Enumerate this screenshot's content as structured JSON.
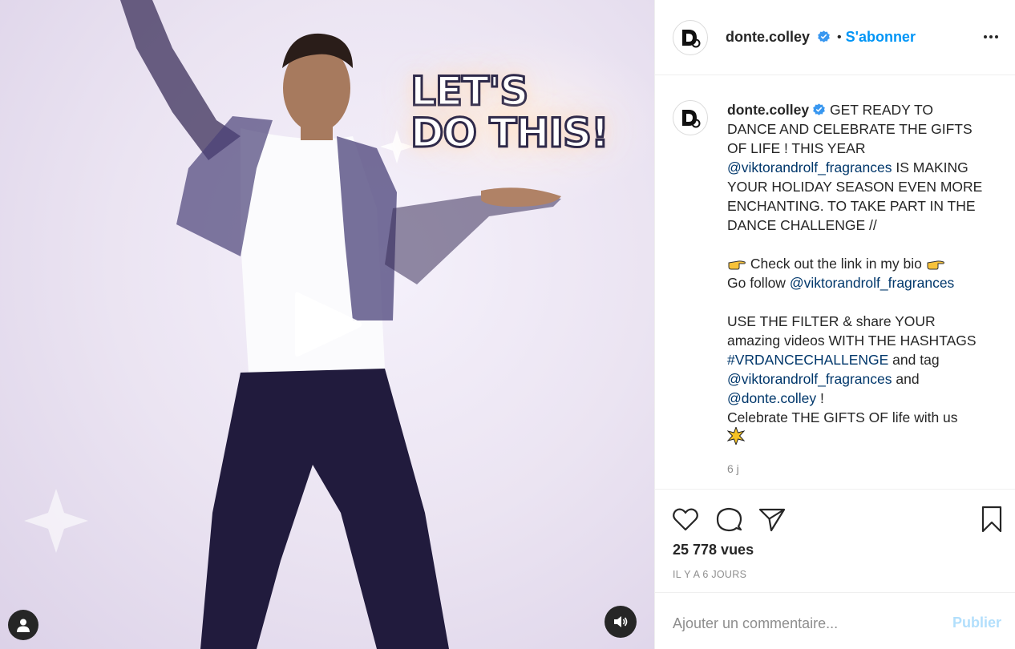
{
  "media": {
    "overlay_line1": "LET'S",
    "overlay_line2": "DO THIS!"
  },
  "header": {
    "username": "donte.colley",
    "separator": "•",
    "follow_label": "S'abonner",
    "more_icon": "more-horizontal-icon"
  },
  "caption": {
    "username": "donte.colley",
    "line1": "GET READY TO",
    "line2": "DANCE AND CELEBRATE THE GIFTS",
    "line3": "OF LIFE ! THIS YEAR",
    "mention1": "@viktorandrolf_fragrances",
    "line4_rest": " IS MAKING",
    "line5": "YOUR HOLIDAY SEASON EVEN MORE",
    "line6": "ENCHANTING. TO TAKE PART IN THE",
    "line7": "DANCE CHALLENGE //",
    "check_text": " Check out the link in my bio ",
    "go_follow": "Go follow ",
    "mention2": "@viktorandrolf_fragrances",
    "use_filter": "USE THE FILTER & share YOUR",
    "amazing": "amazing videos WITH THE HASHTAGS",
    "hashtag": "#VRDANCECHALLENGE",
    "and_tag": " and tag",
    "mention3": "@viktorandrolf_fragrances",
    "and": " and",
    "mention4": "@donte.colley",
    "exclaim": " !",
    "celebrate": "Celebrate THE GIFTS OF life with us",
    "time_ago": "6 j"
  },
  "actions": {
    "views": "25 778 vues",
    "posted": "IL Y A 6 JOURS"
  },
  "comment": {
    "placeholder": "Ajouter un commentaire...",
    "publish_label": "Publier"
  },
  "colors": {
    "link": "#0095f6",
    "mention": "#00376b",
    "verified": "#3897f0",
    "publish_disabled": "#b2dffc"
  }
}
